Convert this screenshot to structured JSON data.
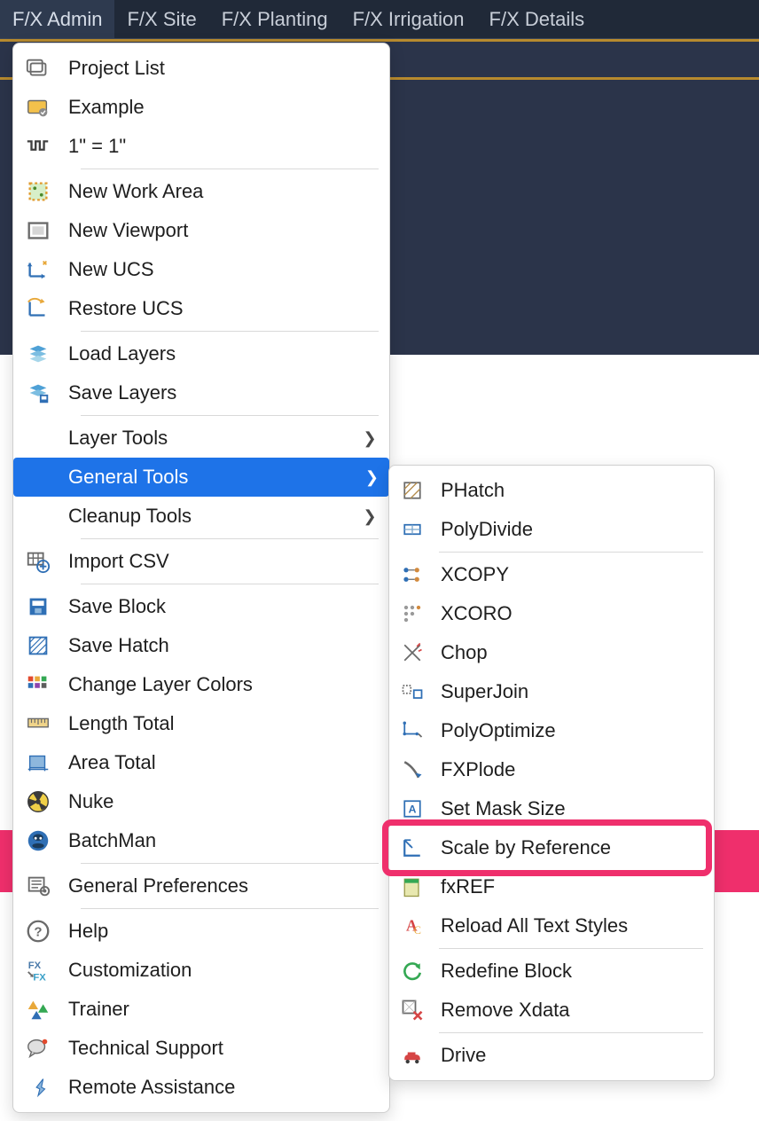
{
  "menubar": {
    "items": [
      "F/X Admin",
      "F/X Site",
      "F/X Planting",
      "F/X Irrigation",
      "F/X Details"
    ],
    "active_index": 0
  },
  "main_menu": {
    "groups": [
      {
        "items": [
          {
            "label": "Project List",
            "icon": "project-list-icon"
          },
          {
            "label": "Example",
            "icon": "example-icon"
          },
          {
            "label": "1\" = 1\"",
            "icon": "scale-icon"
          }
        ]
      },
      {
        "items": [
          {
            "label": "New Work Area",
            "icon": "work-area-icon"
          },
          {
            "label": "New Viewport",
            "icon": "viewport-icon"
          },
          {
            "label": "New UCS",
            "icon": "new-ucs-icon"
          },
          {
            "label": "Restore UCS",
            "icon": "restore-ucs-icon"
          }
        ]
      },
      {
        "items": [
          {
            "label": "Load Layers",
            "icon": "load-layers-icon"
          },
          {
            "label": "Save Layers",
            "icon": "save-layers-icon"
          }
        ]
      },
      {
        "items": [
          {
            "label": "Layer Tools",
            "icon": "",
            "submenu": true
          },
          {
            "label": "General Tools",
            "icon": "",
            "submenu": true,
            "hovered": true
          },
          {
            "label": "Cleanup Tools",
            "icon": "",
            "submenu": true
          }
        ]
      },
      {
        "items": [
          {
            "label": "Import CSV",
            "icon": "import-csv-icon"
          }
        ]
      },
      {
        "items": [
          {
            "label": "Save Block",
            "icon": "save-block-icon"
          },
          {
            "label": "Save Hatch",
            "icon": "save-hatch-icon"
          },
          {
            "label": "Change Layer Colors",
            "icon": "layer-colors-icon"
          },
          {
            "label": "Length Total",
            "icon": "length-total-icon"
          },
          {
            "label": "Area Total",
            "icon": "area-total-icon"
          },
          {
            "label": "Nuke",
            "icon": "nuke-icon"
          },
          {
            "label": "BatchMan",
            "icon": "batchman-icon"
          }
        ]
      },
      {
        "items": [
          {
            "label": "General Preferences",
            "icon": "preferences-icon"
          }
        ]
      },
      {
        "items": [
          {
            "label": "Help",
            "icon": "help-icon"
          },
          {
            "label": "Customization",
            "icon": "customization-icon"
          },
          {
            "label": "Trainer",
            "icon": "trainer-icon"
          },
          {
            "label": "Technical Support",
            "icon": "support-icon"
          },
          {
            "label": "Remote Assistance",
            "icon": "remote-icon"
          }
        ]
      }
    ]
  },
  "sub_menu": {
    "groups": [
      {
        "items": [
          {
            "label": "PHatch",
            "icon": "phatch-icon"
          },
          {
            "label": "PolyDivide",
            "icon": "polydivide-icon"
          }
        ]
      },
      {
        "items": [
          {
            "label": "XCOPY",
            "icon": "xcopy-icon"
          },
          {
            "label": "XCORO",
            "icon": "xcoro-icon"
          },
          {
            "label": "Chop",
            "icon": "chop-icon"
          },
          {
            "label": "SuperJoin",
            "icon": "superjoin-icon"
          },
          {
            "label": "PolyOptimize",
            "icon": "polyoptimize-icon"
          },
          {
            "label": "FXPlode",
            "icon": "fxplode-icon"
          },
          {
            "label": "Set Mask Size",
            "icon": "mask-size-icon"
          },
          {
            "label": "Scale by Reference",
            "icon": "scale-ref-icon",
            "highlighted": true
          },
          {
            "label": "fxREF",
            "icon": "fxref-icon"
          },
          {
            "label": "Reload All Text Styles",
            "icon": "reload-text-icon"
          }
        ]
      },
      {
        "items": [
          {
            "label": "Redefine Block",
            "icon": "redefine-block-icon"
          },
          {
            "label": "Remove Xdata",
            "icon": "remove-xdata-icon"
          }
        ]
      },
      {
        "items": [
          {
            "label": "Drive",
            "icon": "drive-icon"
          }
        ]
      }
    ]
  },
  "icons": {
    "project-list-icon": "<svg viewBox='0 0 32 32' width='30' height='30'><rect x='3' y='6' width='18' height='14' rx='2' fill='none' stroke='#6b6b6b' stroke-width='2'/><rect x='7' y='10' width='18' height='14' rx='2' fill='none' stroke='#6b6b6b' stroke-width='2'/></svg>",
    "example-icon": "<svg viewBox='0 0 32 32' width='30' height='30'><rect x='4' y='8' width='22' height='15' rx='2' fill='#f3c14b' stroke='#6b6b6b' stroke-width='1.5'/><circle cx='22' cy='22' r='5' fill='#8a8a8a'/><path d='M19.5 22l2 2 3-4' stroke='#fff' fill='none' stroke-width='1.5'/></svg>",
    "scale-icon": "<svg viewBox='0 0 32 32' width='30' height='30'><path d='M3 10h5v10h5v-10h5v10h5v-10h5' fill='none' stroke='#404040' stroke-width='2.5'/></svg>",
    "work-area-icon": "<svg viewBox='0 0 32 32' width='30' height='30'><rect x='6' y='6' width='20' height='20' fill='#d7efc8' stroke='#e09a2e' stroke-width='2.5' stroke-dasharray='3 3'/><circle cx='12' cy='12' r='2' fill='#4a8a2a'/><circle cx='20' cy='20' r='2' fill='#4a8a2a'/></svg>",
    "viewport-icon": "<svg viewBox='0 0 32 32' width='30' height='30'><rect x='5' y='7' width='22' height='18' fill='none' stroke='#6a6a6a' stroke-width='2.5'/><rect x='9' y='11' width='14' height='10' fill='#d6d6d6'/></svg>",
    "new-ucs-icon": "<svg viewBox='0 0 32 32' width='30' height='30'><path d='M6 24h18M6 24V8' stroke='#2f6fb5' stroke-width='2.5' fill='none'/><polygon points='24,24 20,21 20,27' fill='#2f6fb5'/><polygon points='6,8 3,12 9,12' fill='#2f6fb5'/><path d='M22 6l4 4m0-4l-4 4' stroke='#e8a83a' stroke-width='2' fill='none'/></svg>",
    "restore-ucs-icon": "<svg viewBox='0 0 32 32' width='30' height='30'><path d='M6 24h18M6 24V8' stroke='#2f6fb5' stroke-width='2.5' fill='none'/><path d='M4 8a10 10 0 0 1 16 0' stroke='#e8a83a' stroke-width='2' fill='none'/><polygon points='20,4 24,8 18,10' fill='#e8a83a'/></svg>",
    "load-layers-icon": "<svg viewBox='0 0 32 32' width='30' height='30'><path d='M6 10l10-4 10 4-10 4z' fill='#4fa1d6'/><path d='M6 16l10-4 10 4-10 4z' fill='#7bbde1'/><path d='M6 22l10-4 10 4-10 4z' fill='#a7d6ea'/></svg>",
    "save-layers-icon": "<svg viewBox='0 0 32 32' width='30' height='30'><path d='M6 10l10-4 10 4-10 4z' fill='#4fa1d6'/><path d='M6 16l10-4 10 4-10 4z' fill='#7bbde1'/><rect x='18' y='18' width='10' height='10' fill='#2f6fb5'/><rect x='20' y='20' width='6' height='4' fill='#fff'/></svg>",
    "import-csv-icon": "<svg viewBox='0 0 32 32' width='30' height='30'><rect x='4' y='6' width='18' height='14' fill='none' stroke='#6a6a6a' stroke-width='2'/><path d='M4 12h18M10 6v14M16 6v14' stroke='#6a6a6a' stroke-width='1.5'/><circle cx='22' cy='22' r='7' fill='none' stroke='#2f6fb5' stroke-width='2'/><path d='M22 18v8M18 22h8' stroke='#2f6fb5' stroke-width='2'/></svg>",
    "save-block-icon": "<svg viewBox='0 0 32 32' width='30' height='30'><rect x='6' y='6' width='20' height='20' fill='#2f6fb5'/><rect x='9' y='9' width='14' height='6' fill='#fff'/><rect x='12' y='18' width='8' height='6' fill='#8db7dd'/></svg>",
    "save-hatch-icon": "<svg viewBox='0 0 32 32' width='30' height='30'><rect x='6' y='6' width='20' height='20' fill='none' stroke='#2f6fb5' stroke-width='2'/><path d='M6 12l6-6M6 20l14-14M6 26l20-20M14 26l12-12M22 26l4-4' stroke='#2f6fb5' stroke-width='1.3'/></svg>",
    "layer-colors-icon": "<svg viewBox='0 0 32 32' width='30' height='30'><rect x='4' y='6' width='6' height='6' fill='#e24a2e'/><rect x='12' y='6' width='6' height='6' fill='#e8a83a'/><rect x='20' y='6' width='6' height='6' fill='#34a853'/><rect x='4' y='14' width='6' height='6' fill='#2f6fb5'/><rect x='12' y='14' width='6' height='6' fill='#8e44ad'/><rect x='20' y='14' width='6' height='6' fill='#5d5d5d'/></svg>",
    "length-total-icon": "<svg viewBox='0 0 32 32' width='30' height='30'><rect x='4' y='10' width='24' height='10' fill='#f0d48a' stroke='#6a6a6a' stroke-width='1.5'/><path d='M8 10v5M12 10v5M16 10v7M20 10v5M24 10v5' stroke='#6a6a6a' stroke-width='1.3'/></svg>",
    "area-total-icon": "<svg viewBox='0 0 32 32' width='30' height='30'><rect x='6' y='8' width='18' height='14' fill='#8db7dd' stroke='#2f6fb5' stroke-width='1.5'/><path d='M4 24h24M6 26v-4M24 26v-4' stroke='#2f6fb5' stroke-width='1.5'/></svg>",
    "nuke-icon": "<svg viewBox='0 0 32 32' width='30' height='30'><circle cx='16' cy='16' r='12' fill='#f0d048' stroke='#3a3a3a' stroke-width='1.5'/><path d='M16 16L10 6a12 12 0 0 1 12 0z M16 16L26 22a12 12 0 0 1-6 4z M16 16L6 22a12 12 0 0 1-2-10z' fill='#3a3a3a'/><circle cx='16' cy='16' r='3' fill='#3a3a3a'/></svg>",
    "batchman-icon": "<svg viewBox='0 0 32 32' width='30' height='30'><circle cx='16' cy='16' r='12' fill='#2f6fb5'/><ellipse cx='16' cy='12' rx='6' ry='4' fill='#1a3a5a'/><ellipse cx='16' cy='22' rx='7' ry='3' fill='#1a3a5a'/><circle cx='13' cy='13' r='1.5' fill='#fff'/><circle cx='19' cy='13' r='1.5' fill='#fff'/></svg>",
    "preferences-icon": "<svg viewBox='0 0 32 32' width='30' height='30'><rect x='5' y='6' width='18' height='16' fill='none' stroke='#6a6a6a' stroke-width='2'/><path d='M8 10h12M8 14h12M8 18h8' stroke='#6a6a6a' stroke-width='1.5'/><circle cx='24' cy='22' r='5' fill='none' stroke='#6a6a6a' stroke-width='2'/><circle cx='24' cy='22' r='2' fill='#6a6a6a'/></svg>",
    "help-icon": "<svg viewBox='0 0 32 32' width='30' height='30'><circle cx='16' cy='16' r='12' fill='none' stroke='#6a6a6a' stroke-width='2.5'/><text x='16' y='22' font-size='16' text-anchor='middle' fill='#6a6a6a' font-weight='bold'>?</text></svg>",
    "customization-icon": "<svg viewBox='0 0 32 32' width='30' height='30'><text x='4' y='14' font-size='12' fill='#4a7aaa' font-weight='bold'>FX</text><text x='10' y='28' font-size='12' fill='#3aa0c8' font-weight='bold'>FX</text><path d='M4 18l6 6' stroke='#6a6a6a' stroke-width='2'/><polygon points='10,24 6,24 10,20' fill='#6a6a6a'/></svg>",
    "trainer-icon": "<svg viewBox='0 0 32 32' width='30' height='30'><polygon points='10,6 16,16 4,16' fill='#e8a83a'/><polygon points='22,10 28,20 16,20' fill='#34a853'/><polygon points='14,18 20,28 8,28' fill='#2f6fb5'/></svg>",
    "support-icon": "<svg viewBox='0 0 32 32' width='30' height='30'><ellipse cx='14' cy='14' rx='10' ry='8' fill='#e0e0e0' stroke='#6a6a6a' stroke-width='1.5'/><path d='M8 20l-2 6 6-4' fill='#e0e0e0' stroke='#6a6a6a' stroke-width='1.5'/><circle cx='24' cy='8' r='3' fill='#e24a2e'/></svg>",
    "remote-icon": "<svg viewBox='0 0 32 32' width='30' height='30'><path d='M16 26l8-8-4-2 2-10-8 10 4 2z' fill='#8db7dd' stroke='#2f6fb5' stroke-width='1.2'/></svg>",
    "phatch-icon": "<svg viewBox='0 0 32 32' width='28' height='28'><rect x='6' y='6' width='20' height='20' fill='none' stroke='#6a6a6a' stroke-width='2'/><path d='M6 14l8-8M6 22l16-16M14 26l12-12' stroke='#b28a4a' stroke-width='1.5'/></svg>",
    "polydivide-icon": "<svg viewBox='0 0 32 32' width='28' height='28'><rect x='6' y='10' width='20' height='12' fill='none' stroke='#2f6fb5' stroke-width='2'/><path d='M6 16h20M16 10v12' stroke='#7aa6cc' stroke-width='1.5'/></svg>",
    "xcopy-icon": "<svg viewBox='0 0 32 32' width='28' height='28'><circle cx='8' cy='10' r='3' fill='#2f6fb5'/><circle cx='8' cy='22' r='3' fill='#2f6fb5'/><circle cx='22' cy='10' r='3' fill='#d28a3e'/><circle cx='22' cy='22' r='3' fill='#d28a3e'/><path d='M11 10h8M11 22h8' stroke='#6a6a6a' stroke-width='1.5'/></svg>",
    "xcoro-icon": "<svg viewBox='0 0 32 32' width='28' height='28'><circle cx='8' cy='8' r='2.5' fill='#9a9a9a'/><circle cx='16' cy='8' r='2.5' fill='#9a9a9a'/><circle cx='24' cy='8' r='2.5' fill='#d28a3e'/><circle cx='8' cy='16' r='2.5' fill='#9a9a9a'/><circle cx='16' cy='16' r='2.5' fill='#9a9a9a'/><circle cx='8' cy='24' r='2.5' fill='#9a9a9a'/></svg>",
    "chop-icon": "<svg viewBox='0 0 32 32' width='28' height='28'><path d='M6 6l20 20M26 6L6 26' stroke='#6a6a6a' stroke-width='2'/><path d='M22 8l4-4M24 14l4-2' stroke='#d64545' stroke-width='2'/></svg>",
    "superjoin-icon": "<svg viewBox='0 0 32 32' width='28' height='28'><rect x='4' y='8' width='10' height='10' fill='none' stroke='#6a6a6a' stroke-width='2' stroke-dasharray='2 2'/><rect x='18' y='14' width='10' height='10' fill='none' stroke='#2f6fb5' stroke-width='2'/></svg>",
    "polyoptimize-icon": "<svg viewBox='0 0 32 32' width='28' height='28'><path d='M6 6v14h16' fill='none' stroke='#2f6fb5' stroke-width='2'/><circle cx='6' cy='6' r='2' fill='#2f6fb5'/><circle cx='6' cy='20' r='2' fill='#2f6fb5'/><circle cx='22' cy='20' r='2' fill='#2f6fb5'/><path d='M24 20l4 4' stroke='#6a6a6a' stroke-width='2'/></svg>",
    "fxplode-icon": "<svg viewBox='0 0 32 32' width='28' height='28'><path d='M6 6c8 4 14 12 18 20' fill='none' stroke='#6a6a6a' stroke-width='3'/><polygon points='24,26 20,20 28,22' fill='#2f6fb5'/></svg>",
    "mask-size-icon": "<svg viewBox='0 0 32 32' width='28' height='28'><rect x='6' y='6' width='20' height='20' fill='none' stroke='#2f6fb5' stroke-width='2'/><text x='16' y='21' font-size='14' text-anchor='middle' fill='#2f6fb5' font-weight='bold'>A</text></svg>",
    "scale-ref-icon": "<svg viewBox='0 0 32 32' width='28' height='28'><path d='M6 6v20h20' fill='none' stroke='#2f6fb5' stroke-width='2.5'/><path d='M6 6h8M6 6l10 10' stroke='#2f6fb5' stroke-width='2'/><polygon points='16,16 12,14 14,12' fill='#2f6fb5'/></svg>",
    "fxref-icon": "<svg viewBox='0 0 32 32' width='28' height='28'><rect x='6' y='6' width='18' height='22' fill='#e8e8b0' stroke='#9a9a4a' stroke-width='1.5'/><rect x='6' y='6' width='18' height='5' fill='#34a853'/></svg>",
    "reload-text-icon": "<svg viewBox='0 0 32 32' width='28' height='28'><text x='8' y='22' font-size='20' fill='#d64545' font-family='serif' font-weight='bold'>A</text><text x='18' y='26' font-size='14' fill='#e8a83a' font-family='serif'>C</text></svg>",
    "redefine-block-icon": "<svg viewBox='0 0 32 32' width='28' height='28'><path d='M24 10a10 10 0 1 0 2 8' fill='none' stroke='#34a853' stroke-width='3'/><polygon points='26,6 20,10 26,14' fill='#34a853'/></svg>",
    "remove-xdata-icon": "<svg viewBox='0 0 32 32' width='28' height='28'><rect x='4' y='4' width='16' height='16' fill='none' stroke='#6a6a6a' stroke-width='2'/><path d='M4 4l16 16M20 4L4 20' stroke='#b8b8b8' stroke-width='1'/><path d='M18 18l10 10M28 18L18 28' stroke='#d64545' stroke-width='3'/></svg>",
    "drive-icon": "<svg viewBox='0 0 32 32' width='28' height='28'><path d='M6 20c0-3 2-5 5-5h10c3 0 5 2 5 5v2H6z' fill='#d64545'/><circle cx='10' cy='24' r='2.5' fill='#3a3a3a'/><circle cx='22' cy='24' r='2.5' fill='#3a3a3a'/><rect x='10' y='12' width='10' height='4' fill='#d64545'/></svg>"
  }
}
